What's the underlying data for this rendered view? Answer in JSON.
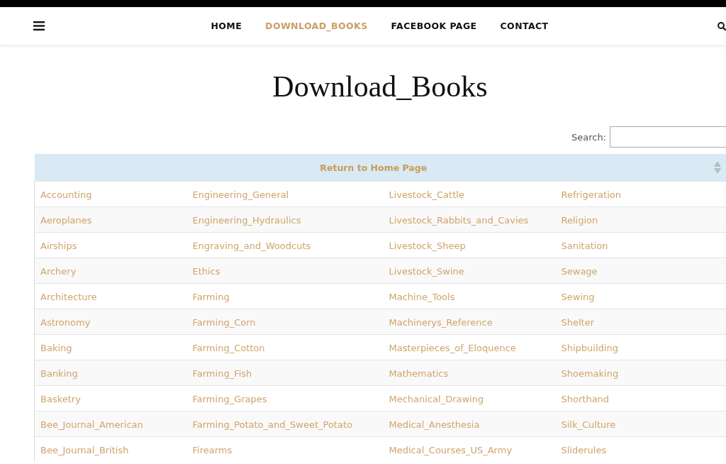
{
  "nav": {
    "items": [
      {
        "label": "HOME",
        "selected": false
      },
      {
        "label": "DOWNLOAD_BOOKS",
        "selected": true
      },
      {
        "label": "FACEBOOK PAGE",
        "selected": false
      },
      {
        "label": "CONTACT",
        "selected": false
      }
    ]
  },
  "page_title": "Download_Books",
  "search": {
    "label": "Search:"
  },
  "table": {
    "header": "Return to Home Page",
    "rows": [
      [
        "Accounting",
        "Engineering_General",
        "Livestock_Cattle",
        "Refrigeration"
      ],
      [
        "Aeroplanes",
        "Engineering_Hydraulics",
        "Livestock_Rabbits_and_Cavies",
        "Religion"
      ],
      [
        "Airships",
        "Engraving_and_Woodcuts",
        "Livestock_Sheep",
        "Sanitation"
      ],
      [
        "Archery",
        "Ethics",
        "Livestock_Swine",
        "Sewage"
      ],
      [
        "Architecture",
        "Farming",
        "Machine_Tools",
        "Sewing"
      ],
      [
        "Astronomy",
        "Farming_Corn",
        "Machinerys_Reference",
        "Shelter"
      ],
      [
        "Baking",
        "Farming_Cotton",
        "Masterpieces_of_Eloquence",
        "Shipbuilding"
      ],
      [
        "Banking",
        "Farming_Fish",
        "Mathematics",
        "Shoemaking"
      ],
      [
        "Basketry",
        "Farming_Grapes",
        "Mechanical_Drawing",
        "Shorthand"
      ],
      [
        "Bee_Journal_American",
        "Farming_Potato_and_Sweet_Potato",
        "Medical_Anesthesia",
        "Silk_Culture"
      ],
      [
        "Bee_Journal_British",
        "Firearms",
        "Medical_Courses_US_Army",
        "Sliderules"
      ]
    ]
  }
}
